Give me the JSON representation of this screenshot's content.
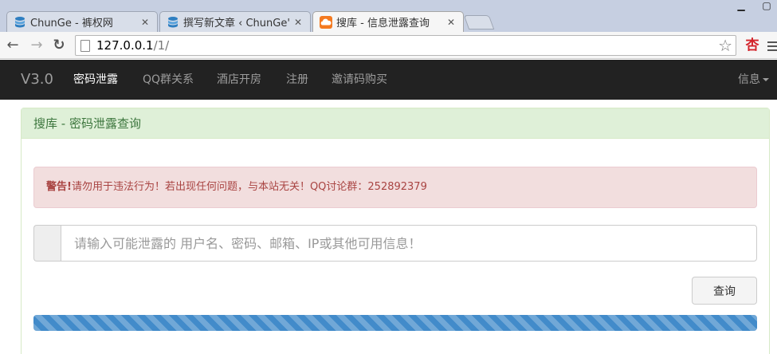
{
  "browser": {
    "tabs": [
      {
        "title": "ChunGe - 裤权网"
      },
      {
        "title": "撰写新文章 ‹ ChunGe's B"
      },
      {
        "title": "搜库 - 信息泄露查询"
      }
    ],
    "address": {
      "host": "127.0.0.1",
      "path": "/1/"
    },
    "colors": {
      "tab_strip": "#c6cfe1",
      "active_tab": "#f6f6f6"
    }
  },
  "navbar": {
    "brand": "V3.0",
    "items": [
      {
        "label": "密码泄露"
      },
      {
        "label": "QQ群关系"
      },
      {
        "label": "酒店开房"
      },
      {
        "label": "注册"
      },
      {
        "label": "邀请码购买"
      }
    ],
    "right_label": "信息",
    "colors": {
      "background": "#222222",
      "text": "#9d9d9d",
      "active_text": "#ffffff"
    }
  },
  "panel": {
    "title": "搜库 - 密码泄露查询",
    "alert": {
      "strong": "警告!",
      "text": "请勿用于违法行为！若出现任何问题，与本站无关！QQ讨论群：252892379"
    },
    "search": {
      "placeholder": "请输入可能泄露的 用户名、密码、邮箱、IP或其他可用信息！",
      "value": "",
      "button_label": "查询"
    },
    "progress": {
      "percent": 100
    },
    "colors": {
      "heading_bg": "#dff0d8",
      "heading_text": "#3c763d",
      "alert_bg": "#f2dede",
      "alert_text": "#a94442",
      "progress": "#428bca"
    }
  }
}
